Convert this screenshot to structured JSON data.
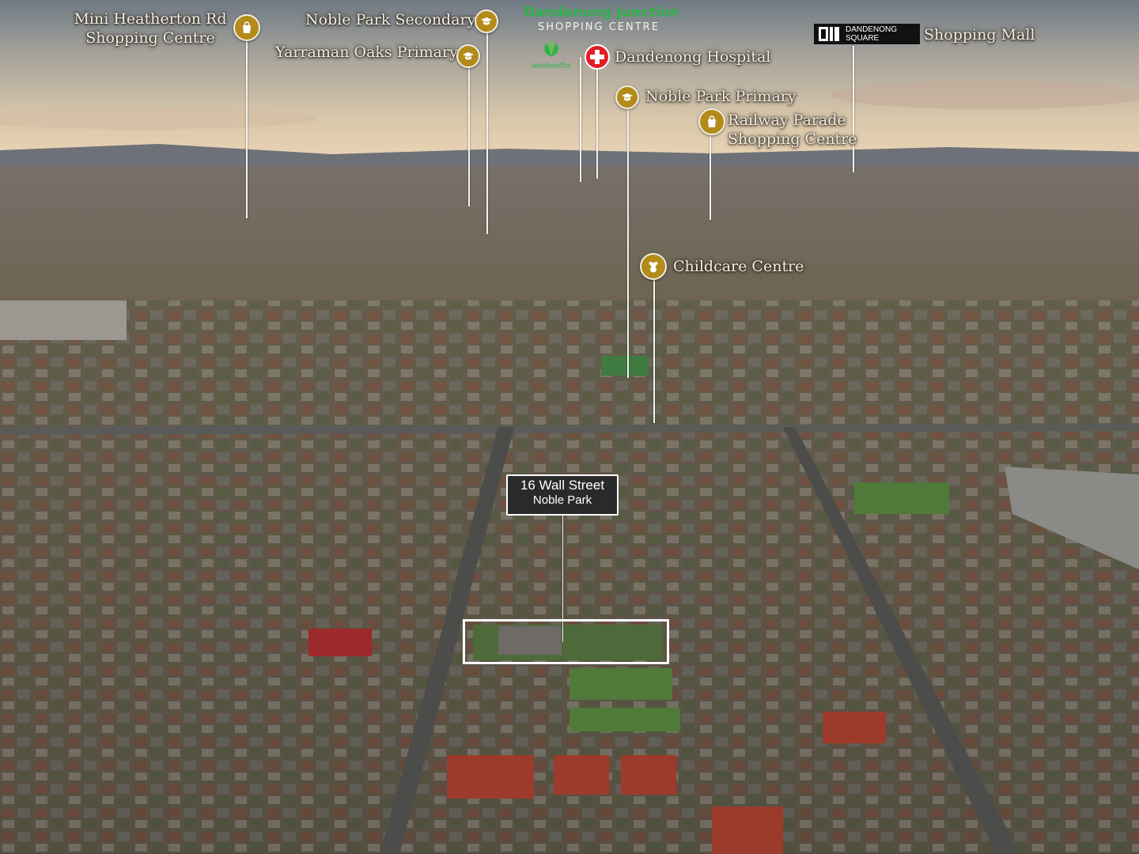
{
  "labels": {
    "mini_heatherton": [
      "Mini Heatherton Rd",
      "Shopping Centre"
    ],
    "noble_park_secondary": "Noble Park Secondary",
    "yarraman_oaks": "Yarraman Oaks Primary",
    "dandenong_junction": {
      "title": "Dandenong Junction",
      "subtitle": "SHOPPING CENTRE"
    },
    "woolworths": "woolworths",
    "dandenong_hospital": "Dandenong Hospital",
    "dandenong_square": {
      "logo_line1": "DANDENONG",
      "logo_line2": "SQUARE",
      "text": "Shopping Mall"
    },
    "noble_park_primary": "Noble Park Primary",
    "railway_parade": [
      "Railway Parade",
      "Shopping Centre"
    ],
    "childcare": "Childcare Centre"
  },
  "property": {
    "street": "16 Wall Street",
    "suburb": "Noble Park"
  },
  "icons": {
    "shopping": "shopping-bag-icon",
    "school": "graduation-cap-icon",
    "hospital": "red-cross-icon",
    "childcare": "teddy-bear-icon"
  },
  "colors": {
    "pin": "#b38b1a",
    "junction_green": "#2fb24a",
    "hospital_red": "#e21e26"
  }
}
